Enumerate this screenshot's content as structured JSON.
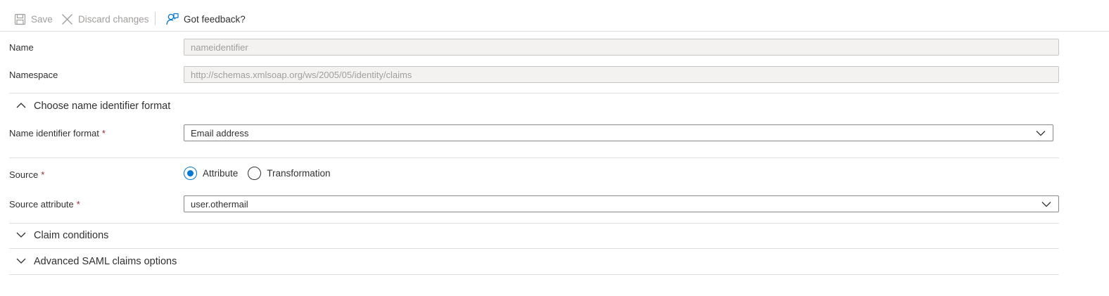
{
  "toolbar": {
    "save_label": "Save",
    "discard_label": "Discard changes",
    "feedback_label": "Got feedback?"
  },
  "form": {
    "name": {
      "label": "Name",
      "value": "nameidentifier"
    },
    "namespace": {
      "label": "Namespace",
      "value": "http://schemas.xmlsoap.org/ws/2005/05/identity/claims"
    },
    "name_id_section": {
      "title": "Choose name identifier format",
      "expanded": true
    },
    "name_id_format": {
      "label": "Name identifier format",
      "required_mark": "*",
      "selected": "Email address"
    },
    "source": {
      "label": "Source",
      "required_mark": "*",
      "options": [
        {
          "label": "Attribute",
          "checked": true
        },
        {
          "label": "Transformation",
          "checked": false
        }
      ]
    },
    "source_attribute": {
      "label": "Source attribute",
      "required_mark": "*",
      "selected": "user.othermail"
    },
    "claim_conditions": {
      "title": "Claim conditions",
      "expanded": false
    },
    "advanced_saml": {
      "title": "Advanced SAML claims options",
      "expanded": false
    }
  },
  "colors": {
    "accent": "#0078d4",
    "required": "#a4262c",
    "disabled_bg": "#f3f2f1",
    "disabled_text": "#a19f9d"
  }
}
